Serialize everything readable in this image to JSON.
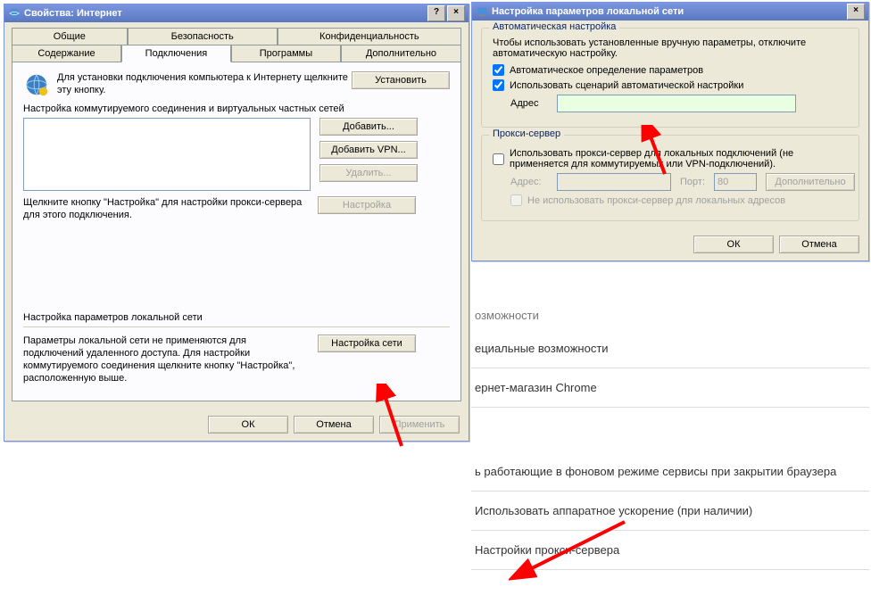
{
  "win1": {
    "title": "Свойства: Интернет",
    "help_btn": "?",
    "close_btn": "×",
    "tabs_row1": [
      "Общие",
      "Безопасность",
      "Конфиденциальность"
    ],
    "tabs_row2": [
      "Содержание",
      "Подключения",
      "Программы",
      "Дополнительно"
    ],
    "install_text": "Для установки подключения компьютера к Интернету щелкните эту кнопку.",
    "install_btn": "Установить",
    "dial_label": "Настройка коммутируемого соединения и виртуальных частных сетей",
    "add_btn": "Добавить...",
    "addvpn_btn": "Добавить VPN...",
    "remove_btn": "Удалить...",
    "settings_btn": "Настройка",
    "settings_hint": "Щелкните кнопку \"Настройка\" для настройки прокси-сервера для этого подключения.",
    "lan_label": "Настройка параметров локальной сети",
    "lan_text": "Параметры локальной сети не применяются для подключений удаленного доступа. Для настройки коммутируемого соединения щелкните кнопку \"Настройка\", расположенную выше.",
    "lan_btn": "Настройка сети",
    "ok": "ОК",
    "cancel": "Отмена",
    "apply": "Применить"
  },
  "win2": {
    "title": "Настройка параметров локальной сети",
    "close_btn": "×",
    "auto_group": "Автоматическая настройка",
    "auto_text": "Чтобы использовать установленные вручную параметры, отключите автоматическую настройку.",
    "auto_detect": "Автоматическое определение параметров",
    "auto_script": "Использовать сценарий автоматической настройки",
    "address_label": "Адрес",
    "proxy_group": "Прокси-сервер",
    "proxy_use": "Использовать прокси-сервер для локальных подключений (не применяется для коммутируемых или VPN-подключений).",
    "proxy_addr_label": "Адрес:",
    "proxy_port_label": "Порт:",
    "proxy_port_value": "80",
    "proxy_adv": "Дополнительно",
    "proxy_bypass": "Не использовать прокси-сервер для локальных адресов",
    "ok": "ОК",
    "cancel": "Отмена"
  },
  "chrome": {
    "heading": "озможности",
    "item1": "ециальные возможности",
    "item2": "ернет-магазин Chrome",
    "item3": "ь работающие в фоновом режиме сервисы при закрытии браузера",
    "item4": "Использовать аппаратное ускорение (при наличии)",
    "item5": "Настройки прокси-сервера"
  }
}
